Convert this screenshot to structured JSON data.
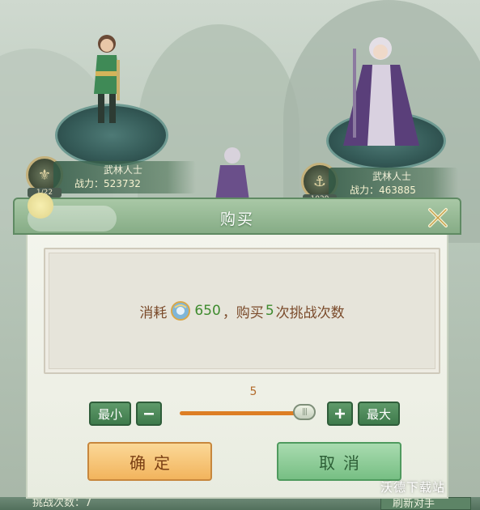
{
  "opponents": [
    {
      "title": "武林人士",
      "power_label": "战力",
      "power_value": "523732",
      "level": "1/22"
    },
    {
      "title": "武林人士",
      "power_label": "战力",
      "power_value": "463885",
      "level": "1029"
    }
  ],
  "dialog": {
    "title": "购买",
    "message": {
      "part1": "消耗",
      "cost": "650",
      "part2": "，购买",
      "count": "5",
      "part3": "次挑战次数"
    },
    "slider": {
      "value": "5",
      "fill": 1.0
    },
    "buttons": {
      "min": "最小",
      "minus": "—",
      "plus": "+",
      "max": "最大",
      "confirm": "确定",
      "cancel": "取消"
    }
  },
  "watermark": "沃德下载站",
  "bottom": {
    "challenge_label": "挑战次数：7",
    "refresh_label": "刷新对手"
  },
  "colors": {
    "header": "#86ac86",
    "confirm": "#f2b45d",
    "cancel": "#77bf84",
    "slider_fill": "#dd7e24",
    "message_text": "#7a4a2a",
    "number_green": "#3e8b2e"
  },
  "icons": {
    "close": "crossed-swords-close-icon",
    "currency": "jade-coin-icon"
  }
}
